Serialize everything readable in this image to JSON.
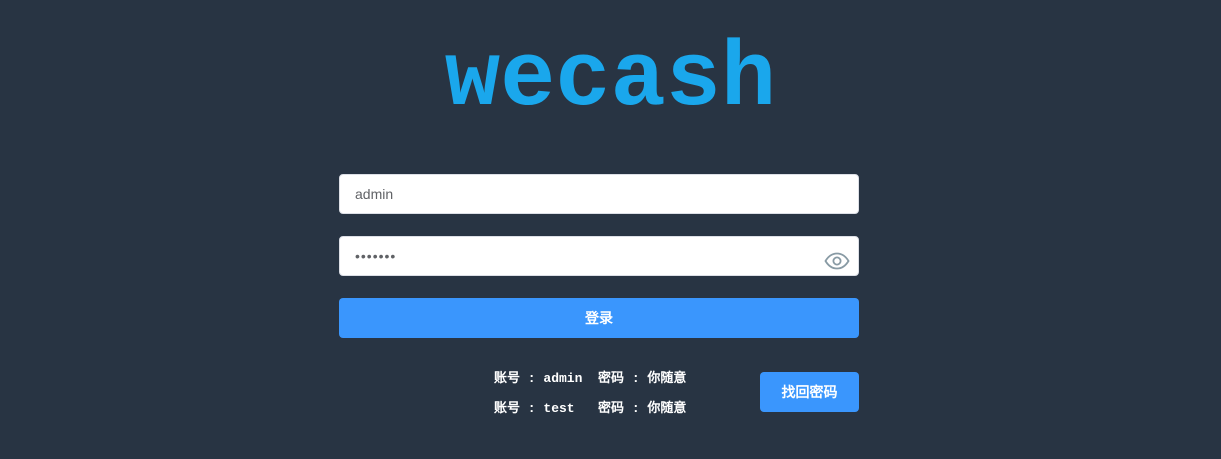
{
  "logo": {
    "text": "wecash"
  },
  "login_form": {
    "username": {
      "value": "admin"
    },
    "password": {
      "value": "1111111"
    },
    "show_password_icon": "eye-icon",
    "login_label": "登录"
  },
  "tips": {
    "line1": "账号 : admin  密码 : 你随意",
    "line2": "账号 : test   密码 : 你随意"
  },
  "recover_button": {
    "label": "找回密码"
  },
  "colors": {
    "background": "#283443",
    "logo": "#1aa7ec",
    "accent": "#3a96fd",
    "icon": "#889aa4"
  }
}
